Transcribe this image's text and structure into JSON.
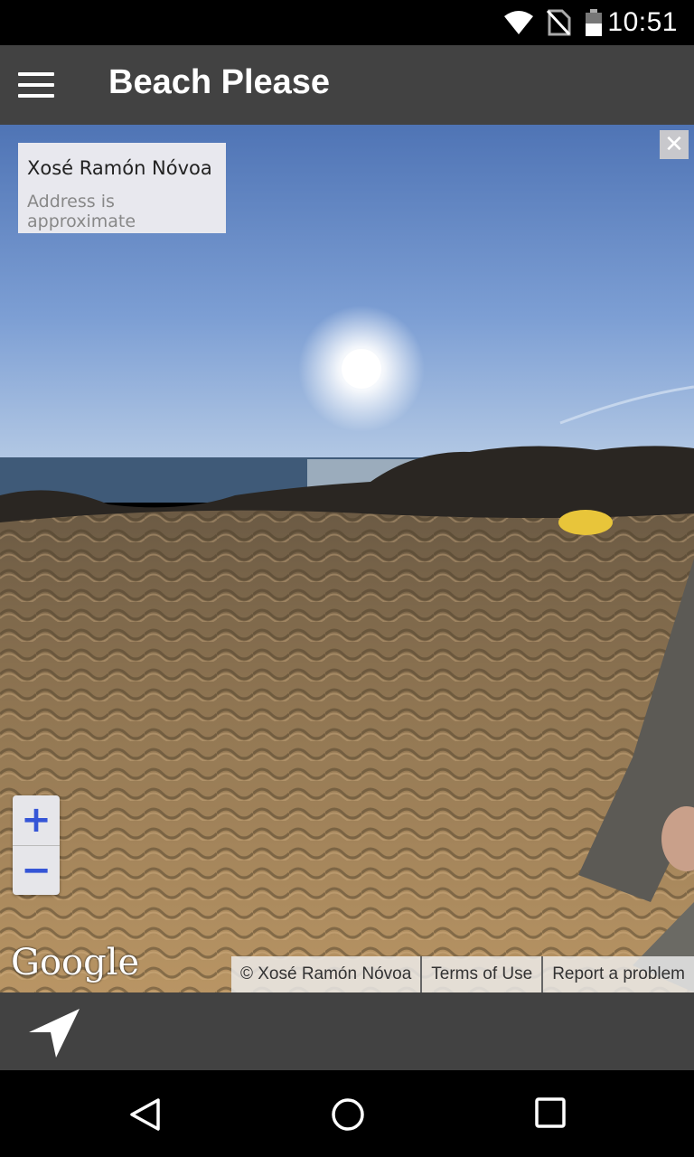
{
  "status_bar": {
    "time": "10:51"
  },
  "app_bar": {
    "title": "Beach Please"
  },
  "info_card": {
    "title": "Xosé Ramón Nóvoa",
    "subtitle": "Address is approximate"
  },
  "close_button": {
    "label": "✕"
  },
  "zoom": {
    "in_label": "+",
    "out_label": "−"
  },
  "google_logo": "Google",
  "attribution": {
    "copyright": "© Xosé Ramón Nóvoa",
    "terms": "Terms of Use",
    "report": "Report a problem"
  }
}
